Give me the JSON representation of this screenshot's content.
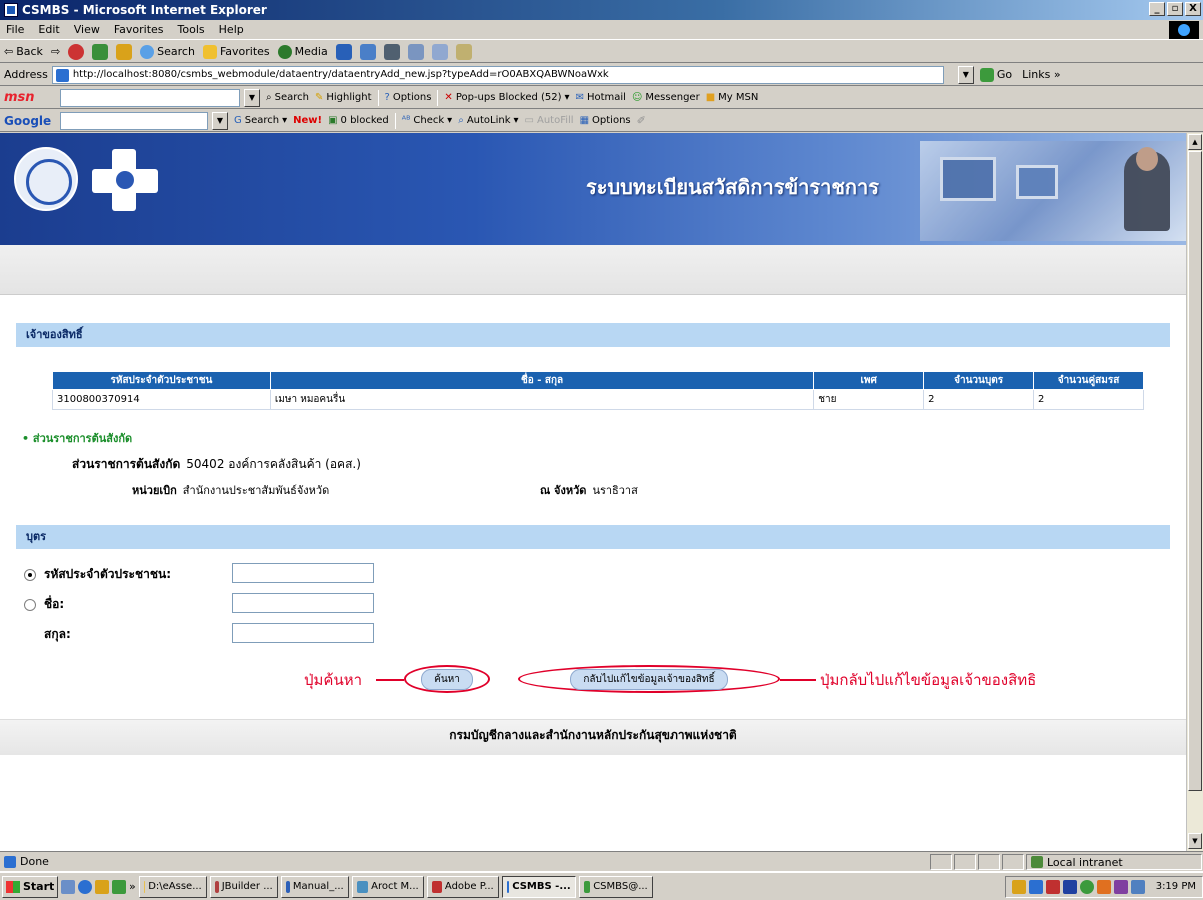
{
  "window": {
    "title": "CSMBS - Microsoft Internet Explorer",
    "min": "_",
    "max": "▫",
    "close": "X"
  },
  "menu": [
    "File",
    "Edit",
    "View",
    "Favorites",
    "Tools",
    "Help"
  ],
  "toolbar": {
    "back": "Back",
    "search": "Search",
    "favorites": "Favorites",
    "media": "Media"
  },
  "address": {
    "label": "Address",
    "url": "http://localhost:8080/csmbs_webmodule/dataentry/dataentryAdd_new.jsp?typeAdd=rO0ABXQABWNoaWxk",
    "go": "Go",
    "links": "Links »"
  },
  "msnbar": {
    "brand": "msn",
    "items": [
      "Search",
      "Highlight",
      "Options",
      "Pop-ups Blocked (52)",
      "Hotmail",
      "Messenger",
      "My MSN"
    ]
  },
  "googlebar": {
    "brand": "Google",
    "items": [
      "Search",
      "New!",
      "0 blocked",
      "Check",
      "AutoLink",
      "AutoFill",
      "Options"
    ]
  },
  "banner": {
    "title": "ระบบทะเบียนสวัสดิการข้าราชการ"
  },
  "owner_section": {
    "heading": "เจ้าของสิทธิ์",
    "columns": [
      "รหัสประจำตัวประชาชน",
      "ชื่อ - สกุล",
      "เพศ",
      "จำนวนบุตร",
      "จำนวนคู่สมรส"
    ],
    "rows": [
      [
        "3100800370914",
        "เมษา หมอคนรื่น",
        "ชาย",
        "2",
        "2"
      ]
    ]
  },
  "agency": {
    "link": "• ส่วนราชการต้นสังกัด",
    "agency_label": "ส่วนราชการต้นสังกัด",
    "agency_value": "50402 องค์การคลังสินค้า (อคส.)",
    "unit_label": "หน่วยเบิก",
    "unit_value": "สำนักงานประชาสัมพันธ์จังหวัด",
    "province_label": "ณ จังหวัด",
    "province_value": "นราธิวาส"
  },
  "child_section": {
    "heading": "บุตร",
    "id_label": "รหัสประจำตัวประชาชน:",
    "name_label": "ชื่อ:",
    "surname_label": "สกุล:"
  },
  "buttons": {
    "search": "ค้นหา",
    "back_owner": "กลับไปแก้ไขข้อมูลเจ้าของสิทธิ์"
  },
  "annotations": {
    "search": "ปุ่มค้นหา",
    "back": "ปุ่มกลับไปแก้ไขข้อมูลเจ้าของสิทธิ"
  },
  "footer": "กรมบัญชีกลางและสำนักงานหลักประกันสุขภาพแห่งชาติ",
  "status": {
    "text": "Done",
    "zone": "Local intranet"
  },
  "taskbar": {
    "start": "Start",
    "tasks": [
      "D:\\eAsse...",
      "JBuilder ...",
      "Manual_...",
      "Aroct M...",
      "Adobe P...",
      "CSMBS -...",
      "CSMBS@..."
    ],
    "clock": "3:19 PM"
  }
}
